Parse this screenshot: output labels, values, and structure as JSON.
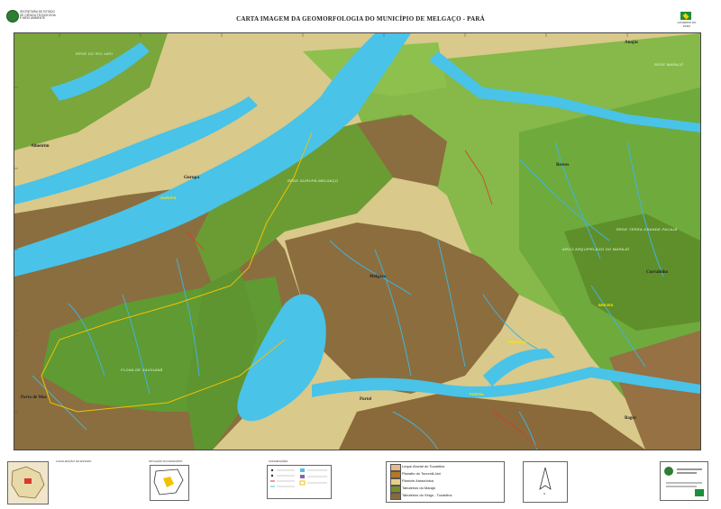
{
  "header": {
    "title": "CARTA IMAGEM DA GEOMORFOLOGIA DO MUNICÍPIO DE MELGAÇO - PARÁ",
    "org_lines": [
      "SECRETARIA DE ESTADO",
      "DE CIÊNCIA TECNOLOGIA",
      "E MEIO AMBIENTE"
    ],
    "flag_caption": "GOVERNO DO PARÁ"
  },
  "places": [
    {
      "key": "almeirim",
      "name": "Almeirim"
    },
    {
      "key": "gurupa",
      "name": "Gurupá"
    },
    {
      "key": "breves",
      "name": "Breves"
    },
    {
      "key": "melgaco",
      "name": "Melgaço"
    },
    {
      "key": "curralinho",
      "name": "Curralinho"
    },
    {
      "key": "porto_moz",
      "name": "Porto de Moz"
    },
    {
      "key": "portel",
      "name": "Portel"
    },
    {
      "key": "bagre",
      "name": "Bagre"
    },
    {
      "key": "anajas",
      "name": "Anajás"
    }
  ],
  "map_units": [
    {
      "key": "rio_jari",
      "name": "REDE DO RIO JARI"
    },
    {
      "key": "gurupa_melgaco",
      "name": "REDE GURUPÁ-MELGAÇO"
    },
    {
      "key": "marajo",
      "name": "REDE MARAJÓ"
    },
    {
      "key": "terra_grande",
      "name": "REDE TERRA GRANDE-PACAJÁ"
    },
    {
      "key": "arquipelago",
      "name": "ARCO ARQUIPÉLAGO DO MARAJÓ"
    },
    {
      "key": "floresta",
      "name": "FLONA DE CAXIUANÃ"
    }
  ],
  "highlighted_labels": [
    {
      "key": "gurupa_y",
      "name": "GURUPÁ"
    },
    {
      "key": "breves_y",
      "name": "BREVES"
    },
    {
      "key": "portel_y",
      "name": "PORTEL"
    },
    {
      "key": "melgaco_y",
      "name": "MELGAÇO"
    }
  ],
  "legend": {
    "items": [
      {
        "label": "Leque Aluvial do Tocantins",
        "color": "#e7b98b"
      },
      {
        "label": "Planalto do Tocumã-Jari",
        "color": "#b7771f"
      },
      {
        "label": "Planície Amazônica",
        "color": "#e5d08b"
      },
      {
        "label": "Tabuleiros do Marajó",
        "color": "#7a8c2e"
      },
      {
        "label": "Tabuleiros do Xingu - Tocantins",
        "color": "#8a6a3a"
      }
    ]
  },
  "footer": {
    "locator_caption": "LOCALIZAÇÃO NO ESTADO",
    "position_caption": "SITUAÇÃO NO MUNICÍPIO",
    "conventions_caption": "CONVENÇÕES",
    "north_caption": "N"
  }
}
